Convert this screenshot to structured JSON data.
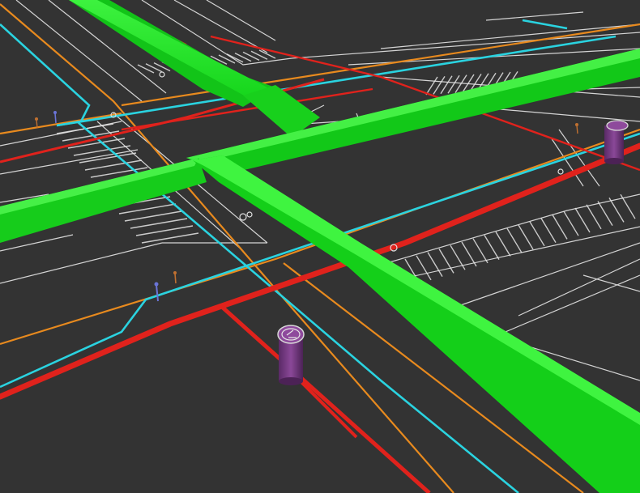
{
  "scene": {
    "kind": "3d-utility-infrastructure-view",
    "background_color": "#333333",
    "layers": [
      {
        "name": "green-trunk-conduit",
        "color": "#14e01a"
      },
      {
        "name": "red-utility-line",
        "color": "#e0221c"
      },
      {
        "name": "cyan-utility-line",
        "color": "#2ad3e0"
      },
      {
        "name": "orange-utility-line",
        "color": "#e88a1e"
      },
      {
        "name": "pavement-markings",
        "color": "#e8e8e8"
      },
      {
        "name": "manhole-structure",
        "color": "#7a3a86"
      },
      {
        "name": "valve-markers",
        "color": "#6a74d6"
      }
    ],
    "structures": [
      {
        "name": "manhole-center",
        "icon": "access-structure-icon"
      },
      {
        "name": "manhole-right",
        "icon": "access-structure-icon"
      }
    ]
  }
}
